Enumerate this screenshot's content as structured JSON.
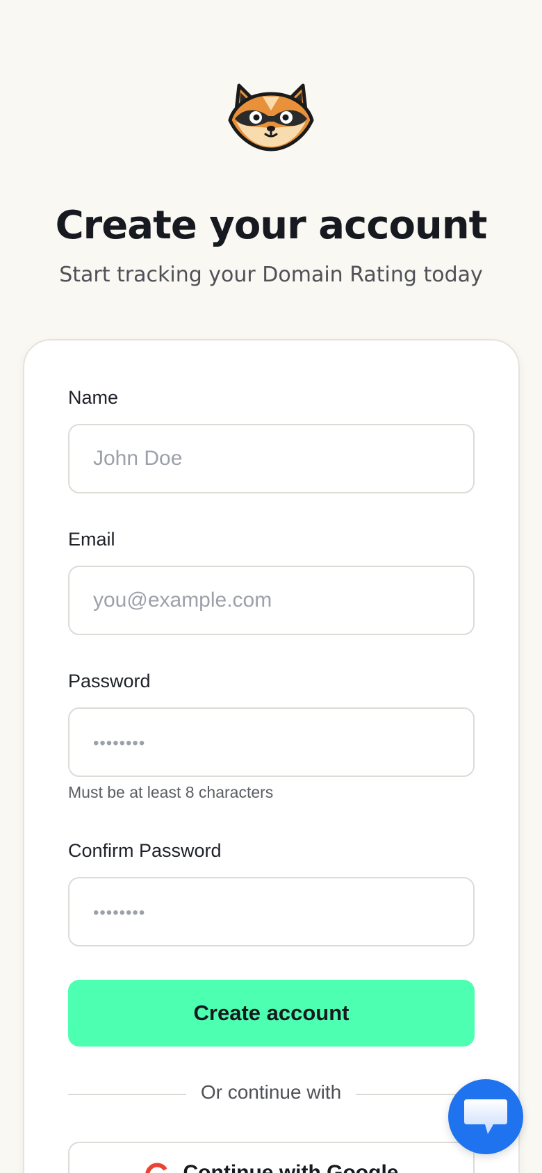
{
  "header": {
    "logo_icon": "raccoon-logo-icon",
    "title": "Create your account",
    "subtitle": "Start tracking your Domain Rating today"
  },
  "form": {
    "name": {
      "label": "Name",
      "placeholder": "John Doe"
    },
    "email": {
      "label": "Email",
      "placeholder": "you@example.com"
    },
    "password": {
      "label": "Password",
      "placeholder": "••••••••",
      "hint": "Must be at least 8 characters"
    },
    "confirm_password": {
      "label": "Confirm Password",
      "placeholder": "••••••••"
    },
    "submit_label": "Create account",
    "divider_text": "Or continue with",
    "google_label": "Continue with Google",
    "google_icon": "google-icon"
  },
  "chat_widget": {
    "icon": "chat-bubble-icon"
  },
  "colors": {
    "background": "#faf8f3",
    "accent": "#4dffb0",
    "chat": "#1f73ee"
  }
}
